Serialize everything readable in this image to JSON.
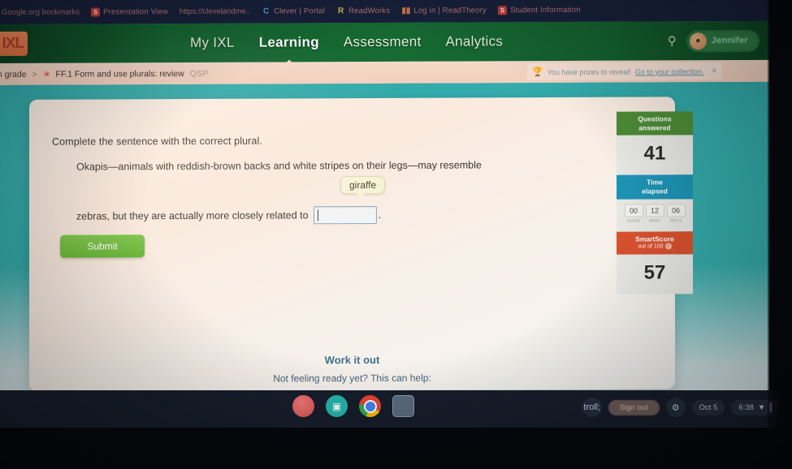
{
  "browser": {
    "bookmarks": [
      {
        "label": "Google.org bookmarks",
        "icon": "none"
      },
      {
        "label": "Presentation View",
        "icon": "red-square-favicon"
      },
      {
        "label": "https://clevelandme..",
        "icon": "none"
      },
      {
        "label": "Clever | Portal",
        "icon": "clever-c-favicon"
      },
      {
        "label": "ReadWorks",
        "icon": "readworks-r-favicon"
      },
      {
        "label": "Log in | ReadTheory",
        "icon": "bars-favicon"
      },
      {
        "label": "Student Information",
        "icon": "red-square-favicon"
      }
    ]
  },
  "nav": {
    "logo": "IXL",
    "links": [
      {
        "label": "My IXL",
        "active": false
      },
      {
        "label": "Learning",
        "active": true
      },
      {
        "label": "Assessment",
        "active": false
      },
      {
        "label": "Analytics",
        "active": false
      }
    ],
    "search_icon": "search-icon",
    "user_name": "Jennifer"
  },
  "breadcrumb": {
    "grade": "th grade",
    "separator": ">",
    "star": "★",
    "skill": "FF.1 Form and use plurals: review",
    "code": "QSP"
  },
  "prize_banner": {
    "trophy": "🏆",
    "text": "You have prizes to reveal!",
    "link": "Go to your collection.",
    "close": "✕"
  },
  "question": {
    "prompt": "Complete the sentence with the correct plural.",
    "sentence_line1": "Okapis—animals with reddish-brown backs and white stripes on their legs—may resemble",
    "tooltip_word": "giraffe",
    "sentence_line2_before": "zebras, but they are actually more closely related to",
    "sentence_line2_after": ".",
    "answer_value": "",
    "submit_label": "Submit"
  },
  "footer": {
    "title": "Work it out",
    "subtitle": "Not feeling ready yet? This can help:"
  },
  "stats": {
    "questions": {
      "head_line1": "Questions",
      "head_line2": "answered",
      "value": "41",
      "color": "#4d8c36"
    },
    "time": {
      "head_line1": "Time",
      "head_line2": "elapsed",
      "color": "#1d94b5",
      "cells": [
        {
          "num": "00",
          "label": "HOUR"
        },
        {
          "num": "12",
          "label": "MINS"
        },
        {
          "num": "06",
          "label": "SECS"
        }
      ]
    },
    "smartscore": {
      "head_line1": "SmartScore",
      "head_line2": "out of 100",
      "info": "i",
      "value": "57",
      "color": "#d9512e"
    }
  },
  "pencil": {
    "icon": "pencil-icon",
    "color": "#2aa7c4"
  },
  "shelf": {
    "dock": [
      {
        "icon": "app-icon-red",
        "glyph": ""
      },
      {
        "icon": "chat-app-icon",
        "glyph": "▣"
      },
      {
        "icon": "chrome-icon",
        "glyph": ""
      },
      {
        "icon": "files-app-icon",
        "glyph": ""
      }
    ],
    "status_icon": "status-chat-icon",
    "signout_label": "Sign out",
    "settings_icon": "gear-icon",
    "date": "Oct 5",
    "time": "6:38",
    "wifi_icon": "▼",
    "battery_icon": "▌"
  }
}
